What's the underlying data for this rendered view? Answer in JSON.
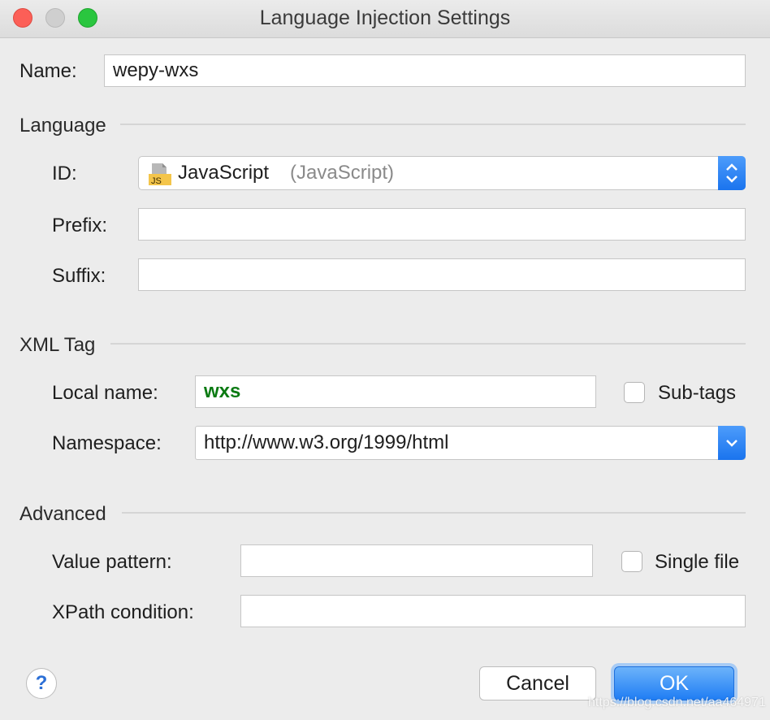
{
  "window": {
    "title": "Language Injection Settings"
  },
  "name": {
    "label": "Name:",
    "value": "wepy-wxs"
  },
  "language_section": {
    "title": "Language",
    "id_label": "ID:",
    "id_value": "JavaScript",
    "id_value_hint": "(JavaScript)",
    "id_icon": "js-file-icon",
    "icon_text": "JS",
    "prefix_label": "Prefix:",
    "prefix_value": "",
    "suffix_label": "Suffix:",
    "suffix_value": ""
  },
  "xml_section": {
    "title": "XML Tag",
    "local_name_label": "Local name:",
    "local_name_value": "wxs",
    "subtags_label": "Sub-tags",
    "subtags_checked": false,
    "namespace_label": "Namespace:",
    "namespace_value": "http://www.w3.org/1999/html"
  },
  "advanced_section": {
    "title": "Advanced",
    "value_pattern_label": "Value pattern:",
    "value_pattern_value": "",
    "single_file_label": "Single file",
    "single_file_checked": false,
    "xpath_label": "XPath condition:",
    "xpath_value": ""
  },
  "footer": {
    "help_label": "?",
    "cancel_label": "Cancel",
    "ok_label": "OK"
  },
  "watermark": "https://blog.csdn.net/aa464971",
  "colors": {
    "accent": "#1a74ee",
    "local_name_text": "#0a7a12",
    "close": "#fc5f57",
    "maximize": "#2ac63f"
  }
}
